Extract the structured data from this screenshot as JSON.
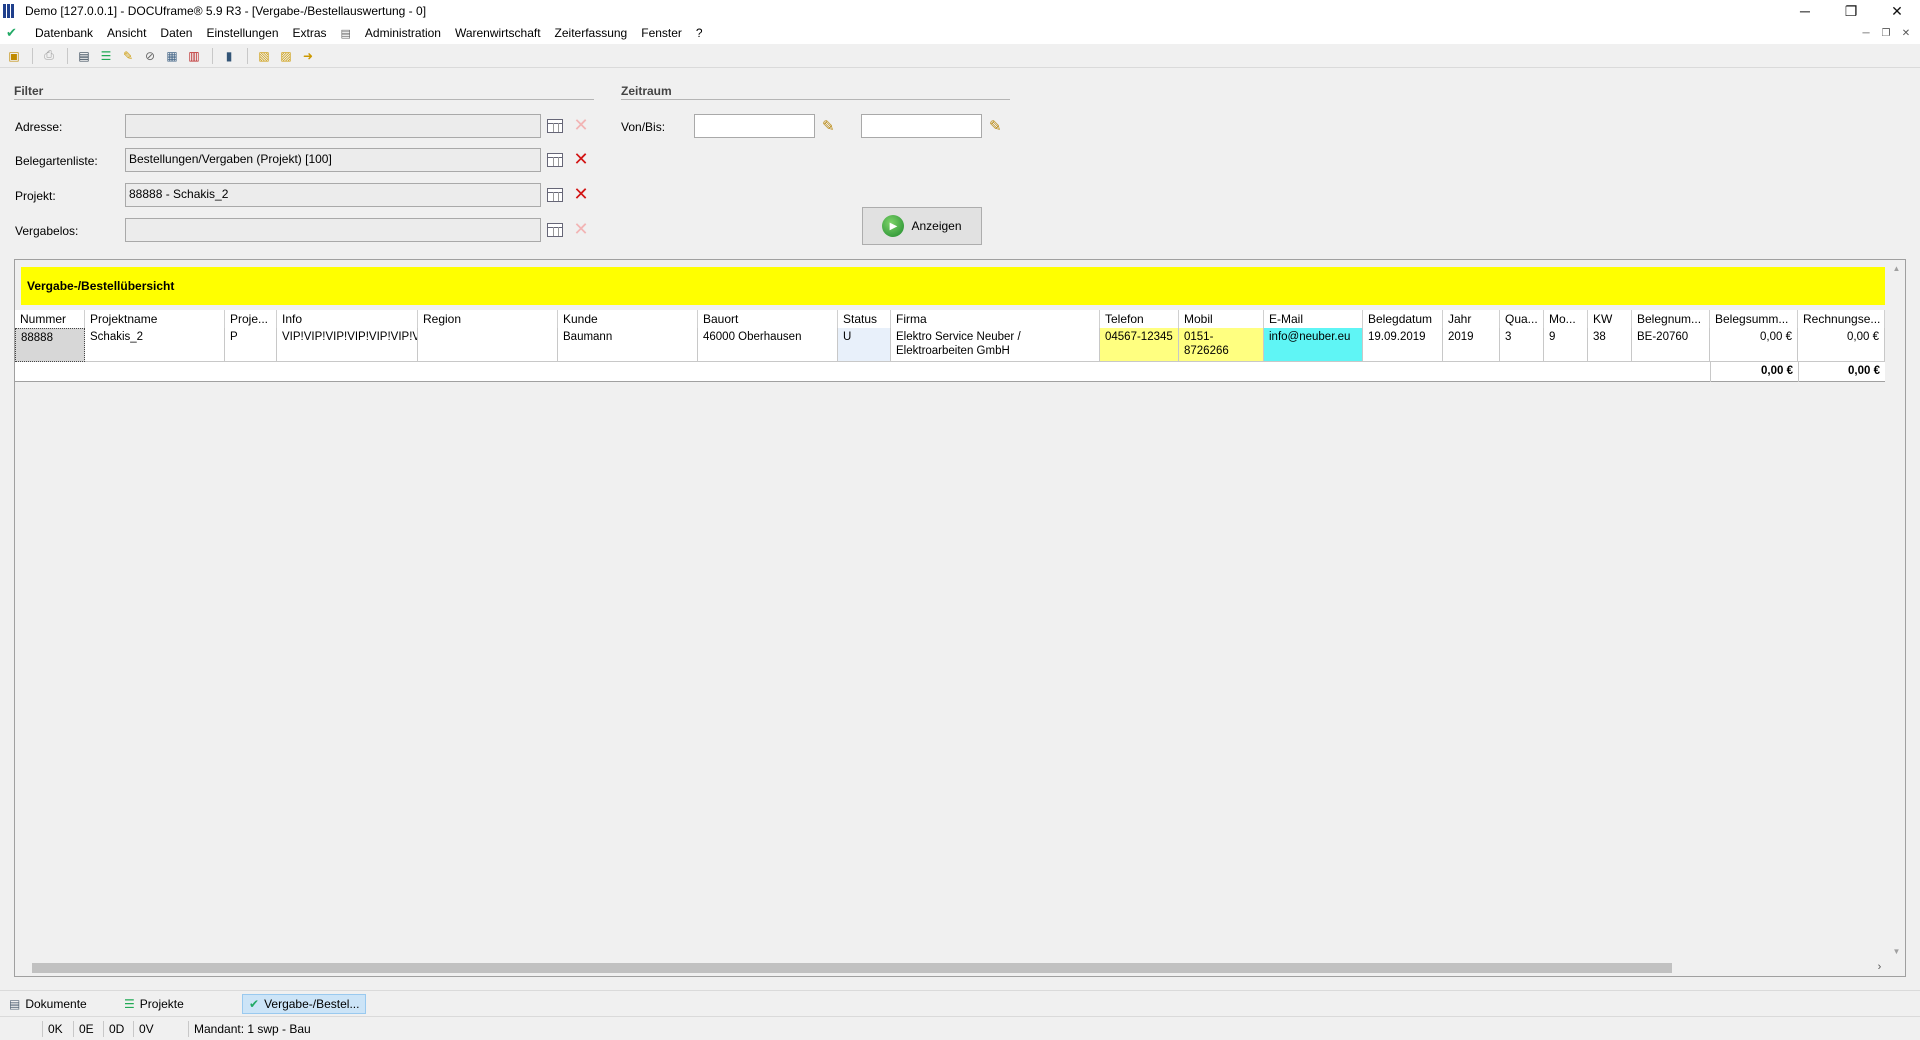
{
  "window": {
    "title": "Demo [127.0.0.1] - DOCUframe® 5.9 R3 - [Vergabe-/Bestellauswertung - 0]",
    "minimize": "─",
    "maximize": "❐",
    "close": "✕"
  },
  "menu": {
    "items": [
      "Datenbank",
      "Ansicht",
      "Daten",
      "Einstellungen",
      "Extras",
      "▤",
      "Administration",
      "Warenwirtschaft",
      "Zeiterfassung",
      "Fenster",
      "?"
    ]
  },
  "filter": {
    "group_title": "Filter",
    "adresse_label": "Adresse:",
    "adresse_value": "",
    "belegartenliste_label": "Belegartenliste:",
    "belegartenliste_value": "Bestellungen/Vergaben (Projekt) [100]",
    "projekt_label": "Projekt:",
    "projekt_value": "88888 - Schakis_2",
    "vergabelos_label": "Vergabelos:",
    "vergabelos_value": ""
  },
  "zeitraum": {
    "group_title": "Zeitraum",
    "von_bis_label": "Von/Bis:",
    "von_value": "",
    "bis_value": ""
  },
  "anzeigen_button": "Anzeigen",
  "grid": {
    "caption": "Vergabe-/Bestellübersicht",
    "columns": [
      "Nummer",
      "Projektname",
      "Proje...",
      "Info",
      "Region",
      "Kunde",
      "Bauort",
      "Status",
      "Firma",
      "Telefon",
      "Mobil",
      "E-Mail",
      "Belegdatum",
      "Jahr",
      "Qua...",
      "Mo...",
      "KW",
      "Belegnum...",
      "Belegsumm...",
      "Rechnungse..."
    ],
    "rows": [
      {
        "nummer": "88888",
        "projektname": "Schakis_2",
        "projekttyp": "P",
        "info": "VIP!VIP!VIP!VIP!VIP!VIP!VI",
        "region": "",
        "kunde": "Baumann",
        "bauort": "46000 Oberhausen",
        "status": "U",
        "firma": "Elektro Service Neuber / Elektroarbeiten GmbH",
        "telefon": "04567-12345",
        "mobil": "0151-8726266",
        "email": "info@neuber.eu",
        "belegdatum": "19.09.2019",
        "jahr": "2019",
        "quartal": "3",
        "monat": "9",
        "kw": "38",
        "belegnummer": "BE-20760",
        "belegsumme": "0,00 €",
        "rechnungssumme": "0,00 €"
      }
    ],
    "sum_belegsumme": "0,00 €",
    "sum_rechnungssumme": "0,00 €"
  },
  "tabs": [
    {
      "label": "Dokumente",
      "icon": "document-icon"
    },
    {
      "label": "Projekte",
      "icon": "list-icon"
    },
    {
      "label": "Vergabe-/Bestel...",
      "icon": "checkmark-icon"
    }
  ],
  "status": {
    "k": "0K",
    "e": "0E",
    "d": "0D",
    "v": "0V",
    "mandant": "Mandant: 1 swp - Bau"
  },
  "colors": {
    "caption_yellow": "#ffff00",
    "phone_highlight": "#ffff80",
    "email_highlight": "#5ff5f5",
    "delete_red": "#d21313"
  }
}
